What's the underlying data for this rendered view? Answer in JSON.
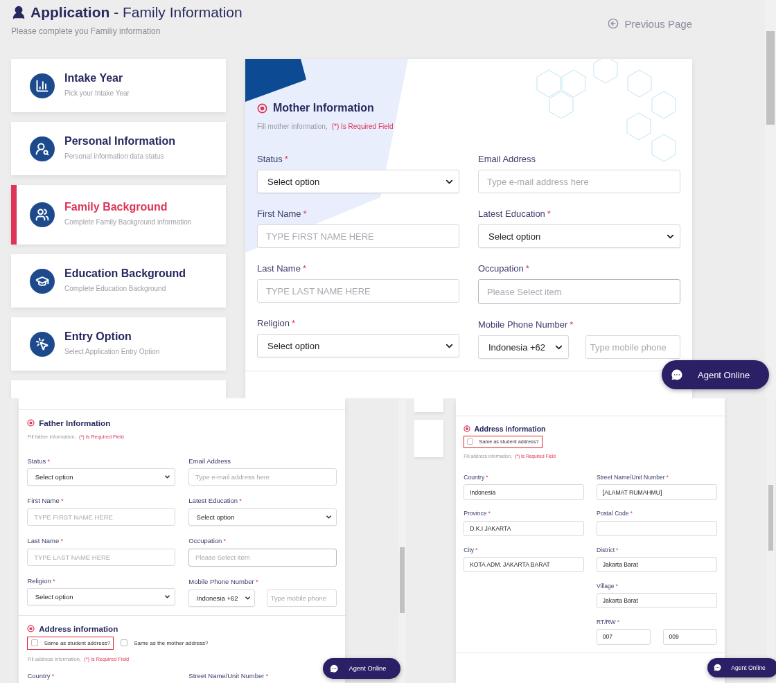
{
  "header": {
    "title_bold": "Application",
    "title_rest": "- Family Information",
    "subtitle": "Please complete you Familiy information",
    "back_link": "Previous Page"
  },
  "steps": [
    {
      "kind": "chart",
      "title": "Intake Year",
      "subtitle": "Pick your Intake Year",
      "selected": false
    },
    {
      "kind": "person",
      "title": "Personal Information",
      "subtitle": "Personal information data status",
      "selected": false
    },
    {
      "kind": "family",
      "title": "Family Background",
      "subtitle": "Complete Family Background information",
      "selected": true
    },
    {
      "kind": "education",
      "title": "Education Background",
      "subtitle": "Complete Education Background",
      "selected": false
    },
    {
      "kind": "cursor",
      "title": "Entry Option",
      "subtitle": "Select Application Entry Option",
      "selected": false
    }
  ],
  "mother_section": {
    "heading": "Mother Information",
    "note": "Fill mother information,",
    "note_required": "(*) Is Required Field",
    "columns": [
      [
        {
          "kind": "select",
          "label": "Status",
          "mark": "*",
          "value": "Select option"
        },
        {
          "kind": "input",
          "label": "First Name",
          "mark": "*",
          "placeholder": "TYPE FIRST NAME HERE"
        },
        {
          "kind": "input",
          "label": "Last Name",
          "mark": "*",
          "placeholder": "TYPE LAST NAME HERE"
        },
        {
          "kind": "select",
          "label": "Religion",
          "mark": "*",
          "value": "Select option"
        }
      ],
      [
        {
          "kind": "input",
          "label": "Email Address",
          "placeholder": "Type e-mail address here"
        },
        {
          "kind": "select",
          "label": "Latest Education",
          "mark": "*",
          "value": "Select option"
        },
        {
          "kind": "picker",
          "label": "Occupation",
          "mark": "*",
          "placeholder": "Please Select item"
        },
        {
          "kind": "phone",
          "label": "Mobile Phone Number",
          "mark": "*",
          "value": "Indonesia +62",
          "placeholder": "Type mobile phone"
        }
      ]
    ]
  },
  "chat_button_top": "Agent Online",
  "father_view": {
    "section": {
      "heading": "Father Information",
      "note": "Fill father information,",
      "note_required": "(*) Is Required Field",
      "columns": [
        [
          {
            "kind": "select",
            "label": "Status",
            "mark": "*",
            "value": "Select option"
          },
          {
            "kind": "input",
            "label": "First Name",
            "mark": "*",
            "placeholder": "TYPE FIRST NAME HERE"
          },
          {
            "kind": "input",
            "label": "Last Name",
            "mark": "*",
            "placeholder": "TYPE LAST NAME HERE"
          },
          {
            "kind": "select",
            "label": "Religion",
            "mark": "*",
            "value": "Select option"
          }
        ],
        [
          {
            "kind": "input",
            "label": "Email Address",
            "placeholder": "Type e-mail address here"
          },
          {
            "kind": "select",
            "label": "Latest Education",
            "mark": "*",
            "value": "Select option"
          },
          {
            "kind": "picker",
            "label": "Occupation",
            "mark": "*",
            "placeholder": "Please Select item"
          },
          {
            "kind": "phone",
            "label": "Mobile Phone Number",
            "mark": "*",
            "value": "Indonesia +62",
            "placeholder": "Type mobile phone"
          }
        ]
      ]
    },
    "address": {
      "heading": "Address information",
      "options": [
        {
          "label": "Same as student address?",
          "checked": false,
          "outlined": true
        },
        {
          "label": "Same as the mother address?",
          "checked": false,
          "outlined": false
        }
      ],
      "note": "Fill address information,",
      "note_required": "(*) Is Required Field",
      "columns": [
        [
          {
            "kind": "cut",
            "label": "Country",
            "mark": "*"
          }
        ],
        [
          {
            "kind": "cut",
            "label": "Street Name/Unit Number",
            "mark": "*"
          }
        ]
      ]
    },
    "chat_button": "Agent Online"
  },
  "address_view": {
    "address": {
      "heading": "Address information",
      "options": [
        {
          "label": "Same as student address?",
          "checked": false,
          "outlined": true
        }
      ],
      "note": "Fill address information,",
      "note_required": "(*) Is Required Field",
      "columns": [
        [
          {
            "kind": "input",
            "label": "Country",
            "mark": "*",
            "value": "Indonesia"
          },
          {
            "kind": "input",
            "label": "Province",
            "mark": "*",
            "value": "D.K.I JAKARTA"
          },
          {
            "kind": "input",
            "label": "City",
            "mark": "*",
            "value": "KOTA ADM. JAKARTA BARAT"
          }
        ],
        [
          {
            "kind": "input",
            "label": "Street Name/Unit Number",
            "mark": "*",
            "value": "[ALAMAT RUMAHMU]"
          },
          {
            "kind": "input",
            "label": "Postal Code",
            "mark": "*"
          },
          {
            "kind": "input",
            "label": "District",
            "mark": "*",
            "value": "Jakarta Barat"
          },
          {
            "kind": "input",
            "label": "Village",
            "mark": "*",
            "value": "Jakarta Barat"
          },
          {
            "kind": "pair",
            "label": "RT/RW",
            "mark": "*",
            "values": [
              "007",
              "009"
            ]
          }
        ]
      ]
    },
    "chat_button": "Agent Online"
  }
}
